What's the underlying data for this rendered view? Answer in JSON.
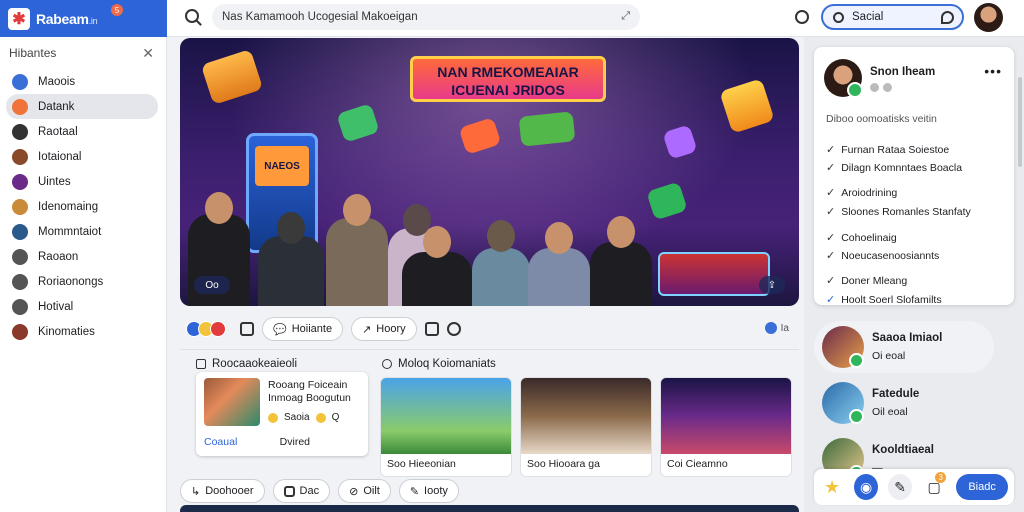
{
  "brand": {
    "name": "Rabeam",
    "suffix": ".in",
    "notif_count": "5"
  },
  "topbar": {
    "search_text": "Nas Kamamooh Ucogesial Makoeigan",
    "pill_label": "Sacial"
  },
  "sidebar": {
    "header": "Hibantes",
    "items": [
      {
        "label": "Maoois",
        "color": "#3a6fd8"
      },
      {
        "label": "Datank",
        "color": "#f0733a"
      },
      {
        "label": "Raotaal",
        "color": "#333333"
      },
      {
        "label": "Iotaional",
        "color": "#8a4a2a"
      },
      {
        "label": "Uintes",
        "color": "#6a2a8a"
      },
      {
        "label": "Idenomaing",
        "color": "#c98a3a"
      },
      {
        "label": "Mommntaiot",
        "color": "#2a5a8a"
      },
      {
        "label": "Raoaon",
        "color": "#555555"
      },
      {
        "label": "Roriaonongs",
        "color": "#555555"
      },
      {
        "label": "Hotival",
        "color": "#555555"
      },
      {
        "label": "Kinomaties",
        "color": "#8a3a2a"
      }
    ]
  },
  "hero": {
    "banner_line1": "NAN RMEKOMEAIAR",
    "banner_line2": "ICUENAI JRIDOS",
    "arcade_text": "NAEOS",
    "tag": "Oo",
    "share": "⇪"
  },
  "actions": {
    "chip1": "Hoiiante",
    "chip2": "Hoory",
    "right_text": "Ia"
  },
  "section": {
    "left_title": "Roocaaokeaieoli",
    "right_title": "Moloq Koiomaniats",
    "card_text": "Rooang Foiceain Inmoag Boogutun",
    "card_r1": "Saoia",
    "card_r2": "Q",
    "card_cta": "Coaual",
    "card_meta": "Dvired",
    "tiles": [
      {
        "caption": "Soo Hieeonian"
      },
      {
        "caption": "Soo Hiooara ga"
      },
      {
        "caption": "Coi Cieamno"
      }
    ]
  },
  "bottom": {
    "c1": "Doohooer",
    "c2": "Dac",
    "c3": "Oilt",
    "c4": "Iooty"
  },
  "panel": {
    "name": "Snon Iheam",
    "subtitle": "Diboo oomoatisks veitin",
    "checks": [
      "Furnan Rataa Soiestoe",
      "Dilagn Komnntaes Boacla",
      "Aroiodrining",
      "Sloones Romanles Stanfaty",
      "Cohoelinaig",
      "Noeucasenoosiannts",
      "Doner Mleang",
      "Hoolt Soerl Slofamilts"
    ]
  },
  "contacts": [
    {
      "name": "Saaoa Imiaol",
      "status": "Oi eoal"
    },
    {
      "name": "Fatedule",
      "status": "Oil eoal"
    },
    {
      "name": "Kooldtiaeal",
      "status": "—"
    }
  ],
  "dock": {
    "go_label": "Biadc",
    "badge": "3"
  }
}
